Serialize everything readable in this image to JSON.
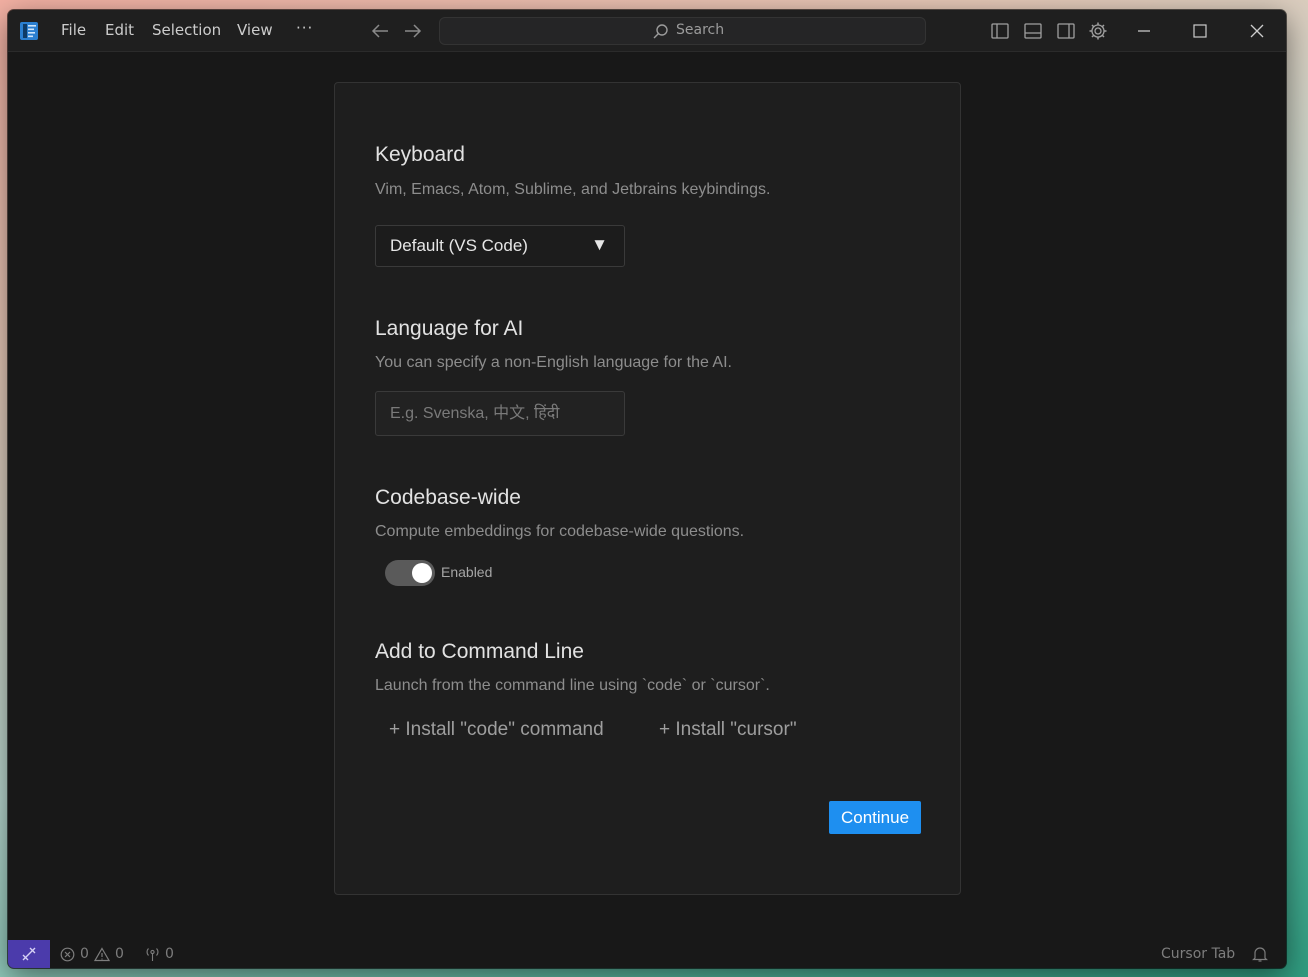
{
  "titlebar": {
    "menu": [
      "File",
      "Edit",
      "Selection",
      "View"
    ],
    "more_label": "···",
    "search_label": "Search"
  },
  "keyboard": {
    "title": "Keyboard",
    "description": "Vim, Emacs, Atom, Sublime, and Jetbrains keybindings.",
    "selected": "Default (VS Code)"
  },
  "language": {
    "title": "Language for AI",
    "description": "You can specify a non-English language for the AI.",
    "placeholder": "E.g. Svenska, 中文, हिंदी",
    "value": ""
  },
  "codebase": {
    "title": "Codebase-wide",
    "description": "Compute embeddings for codebase-wide questions.",
    "toggle_label": "Enabled",
    "enabled": true
  },
  "command_line": {
    "title": "Add to Command Line",
    "description": "Launch from the command line using `code` or `cursor`.",
    "install_code": "+ Install \"code\" command",
    "install_cursor": "+ Install \"cursor\""
  },
  "continue_label": "Continue",
  "statusbar": {
    "errors": "0",
    "warnings": "0",
    "ports": "0",
    "cursor_tab": "Cursor Tab"
  },
  "colors": {
    "accent": "#1e8ff0",
    "remote": "#4b3bab",
    "background": "#181818",
    "panel": "#1e1e1e"
  },
  "icons": [
    "app-logo-icon",
    "arrow-left-icon",
    "arrow-right-icon",
    "search-icon",
    "toggle-sidebar-icon",
    "toggle-panel-icon",
    "toggle-secondary-sidebar-icon",
    "gear-icon",
    "minimize-icon",
    "maximize-icon",
    "close-icon",
    "remote-icon",
    "error-icon",
    "warning-icon",
    "ports-icon",
    "bell-icon",
    "dropdown-arrow-icon"
  ]
}
